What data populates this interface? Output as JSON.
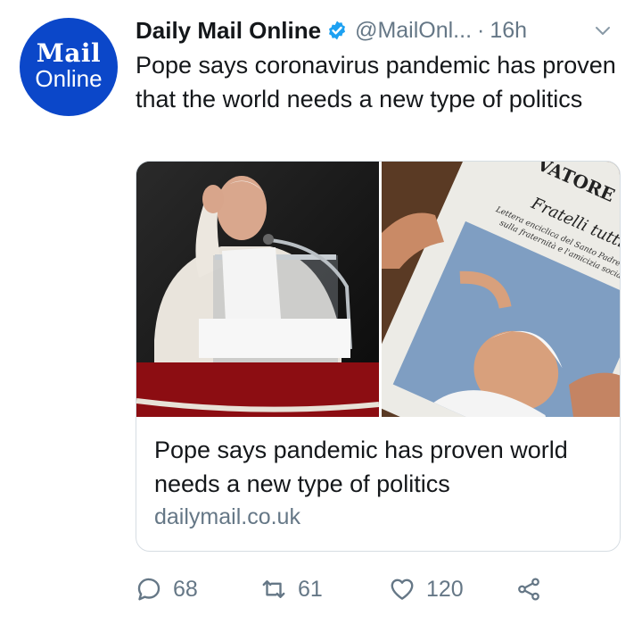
{
  "account": {
    "avatar_line1": "Mail",
    "avatar_line2": "Online",
    "name": "Daily Mail Online",
    "handle": "@MailOnl...",
    "separator": "·",
    "time": "16h"
  },
  "tweet": {
    "text": "Pope says coronavirus pandemic has proven that the world needs a new type of politics"
  },
  "card": {
    "title": "Pope says pandemic has proven world needs a new type of politics",
    "domain": "dailymail.co.uk",
    "newspaper_masthead": "VATORE",
    "newspaper_headline": "Fratelli tutti",
    "newspaper_sub1": "Lettera enciclica del Santo Padre Francesco",
    "newspaper_sub2": "sulla fraternità e l'amicizia sociale"
  },
  "actions": {
    "replies": "68",
    "retweets": "61",
    "likes": "120"
  },
  "colors": {
    "avatar_bg": "#0b47c9",
    "verified": "#1da1f2",
    "muted": "#657786",
    "text": "#14171a"
  },
  "icons": [
    "verified-badge-icon",
    "chevron-down-icon",
    "reply-icon",
    "retweet-icon",
    "like-icon",
    "share-icon"
  ]
}
